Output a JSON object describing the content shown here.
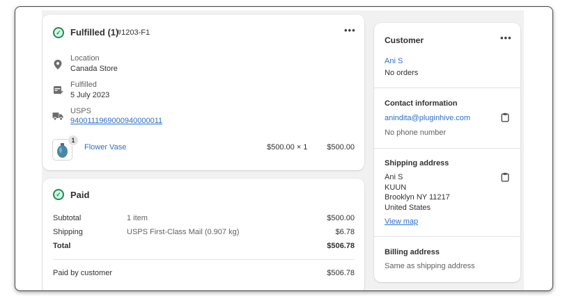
{
  "fulfillment": {
    "title": "Fulfilled (1)",
    "order_id": "#1203-F1",
    "menu_glyph": "•••",
    "location_label": "Location",
    "location_value": "Canada Store",
    "fulfilled_label": "Fulfilled",
    "fulfilled_date": "5 July 2023",
    "carrier_label": "USPS",
    "tracking_number": "9400111969000940000011",
    "item": {
      "name": "Flower Vase",
      "quantity_badge": "1",
      "price_qty": "$500.00 × 1",
      "total": "$500.00"
    }
  },
  "payment": {
    "title": "Paid",
    "rows": [
      {
        "label": "Subtotal",
        "detail": "1 item",
        "amount": "$500.00"
      },
      {
        "label": "Shipping",
        "detail": "USPS First-Class Mail (0.907 kg)",
        "amount": "$6.78"
      }
    ],
    "total_label": "Total",
    "total_amount": "$506.78",
    "paid_by_label": "Paid by customer",
    "paid_by_amount": "$506.78"
  },
  "customer": {
    "title": "Customer",
    "menu_glyph": "•••",
    "name": "Ani S",
    "orders": "No orders",
    "contact_title": "Contact information",
    "email": "anindita@pluginhive.com",
    "phone": "No phone number",
    "shipping_title": "Shipping address",
    "address_lines": [
      "Ani S",
      "KUUN",
      "Brooklyn NY 11217",
      "United States"
    ],
    "view_map": "View map",
    "billing_title": "Billing address",
    "billing_value": "Same as shipping address"
  },
  "colors": {
    "accent_link": "#2c6ecb",
    "success": "#29845a",
    "background": "#f1f1f1"
  },
  "icons": {
    "fulfilled_status": "check-circle-icon",
    "paid_status": "check-circle-icon",
    "location": "location-pin-icon",
    "fulfilled": "calendar-check-icon",
    "carrier": "truck-icon",
    "copy": "clipboard-icon",
    "product": "vase-thumbnail"
  }
}
